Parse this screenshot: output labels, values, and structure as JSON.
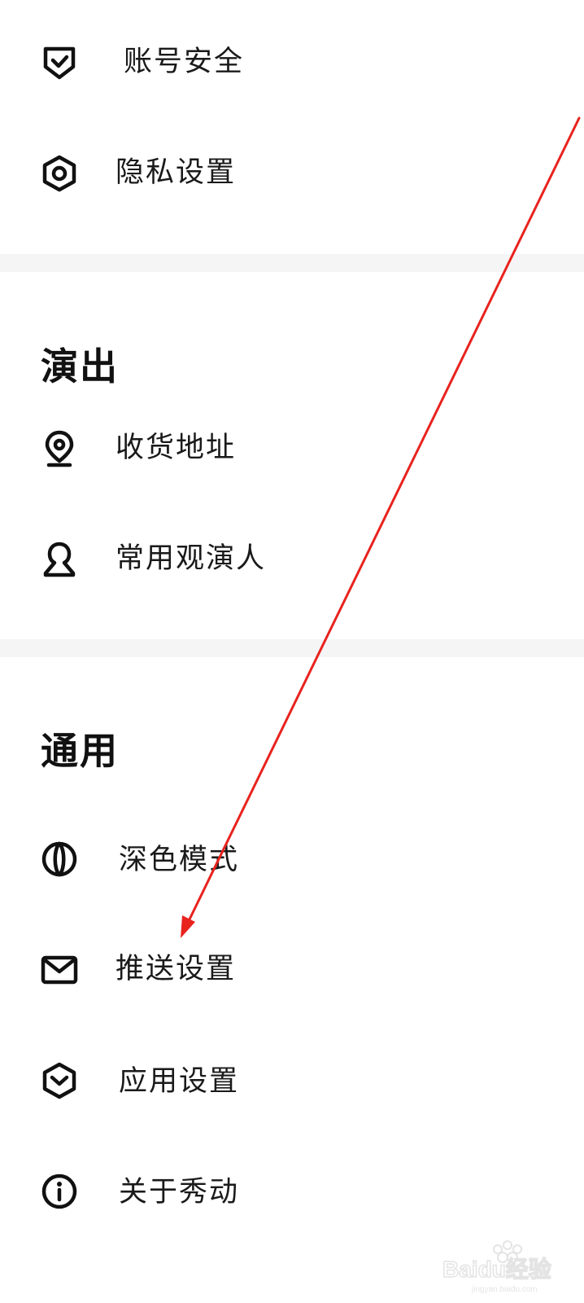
{
  "sections": {
    "account": {
      "items": [
        {
          "label": "账号安全",
          "icon": "shield-check-icon"
        },
        {
          "label": "隐私设置",
          "icon": "hexagon-settings-icon"
        }
      ]
    },
    "show": {
      "title": "演出",
      "items": [
        {
          "label": "收货地址",
          "icon": "location-pin-icon"
        },
        {
          "label": "常用观演人",
          "icon": "user-icon"
        }
      ]
    },
    "general": {
      "title": "通用",
      "items": [
        {
          "label": "深色模式",
          "icon": "dark-mode-icon"
        },
        {
          "label": "推送设置",
          "icon": "envelope-icon"
        },
        {
          "label": "应用设置",
          "icon": "hexagon-chevron-icon"
        },
        {
          "label": "关于秀动",
          "icon": "info-icon"
        }
      ]
    }
  },
  "annotation": {
    "arrow_color": "#e8231e"
  },
  "watermark": {
    "text": "Baidu经验",
    "subtext": "jingyan.baidu.com"
  },
  "colors": {
    "background": "#ffffff",
    "divider": "#f5f5f5",
    "text": "#1a1a1a"
  }
}
